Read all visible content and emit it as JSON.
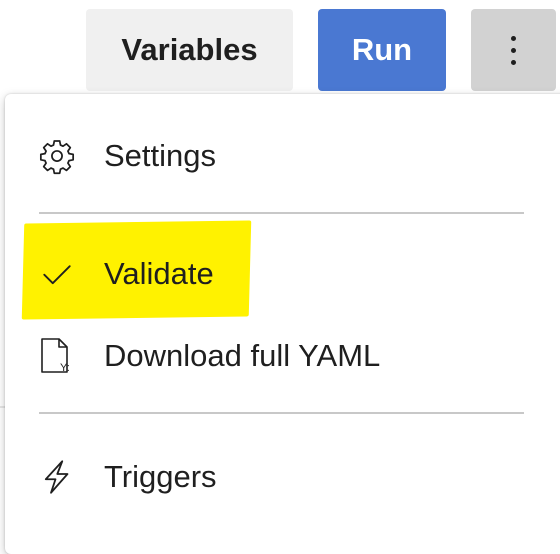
{
  "toolbar": {
    "variables_label": "Variables",
    "run_label": "Run",
    "more_icon": "vertical-ellipsis-icon"
  },
  "menu": {
    "items": [
      {
        "label": "Settings",
        "icon": "gear-icon"
      },
      {
        "label": "Validate",
        "icon": "checkmark-icon",
        "highlighted": true
      },
      {
        "label": "Download full YAML",
        "icon": "yaml-file-icon",
        "icon_text": "Y:"
      },
      {
        "label": "Triggers",
        "icon": "lightning-icon"
      }
    ]
  },
  "colors": {
    "run_button": "#4a78d2",
    "variables_button": "#f0f0f0",
    "more_button": "#d2d2d2",
    "highlight": "#fff200",
    "text": "#1f1f1f",
    "divider": "#c8c8c8"
  }
}
